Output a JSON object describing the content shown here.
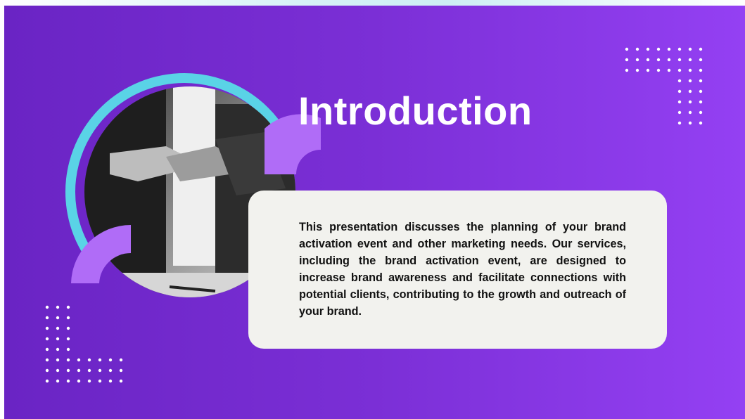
{
  "slide": {
    "title": "Introduction",
    "body": "This presentation discusses the planning of your brand activation event and other marketing needs. Our services, including the brand activation event, are designed to increase brand awareness and facilitate connections with potential clients, contributing to the growth and outreach of your brand."
  },
  "colors": {
    "background_start": "#6a24c4",
    "background_end": "#9440f3",
    "accent_cyan": "#5ad3e6",
    "accent_purple": "#b06cf7",
    "card": "#f2f2ee"
  }
}
